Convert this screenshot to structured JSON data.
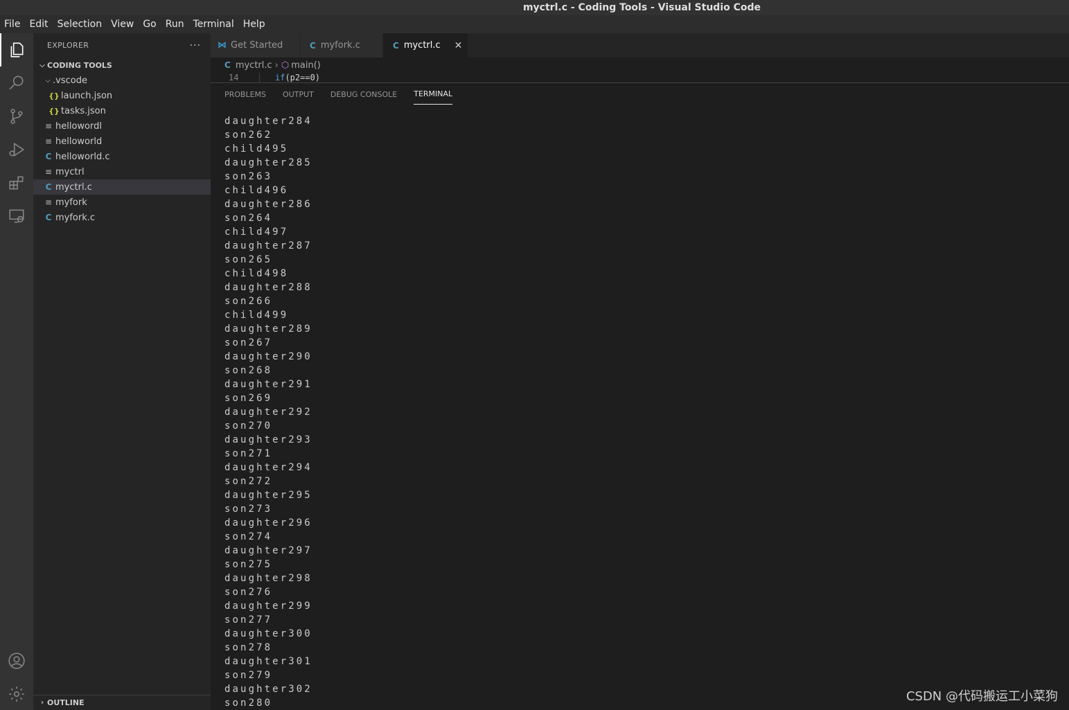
{
  "window": {
    "title": "myctrl.c - Coding Tools - Visual Studio Code"
  },
  "menu": [
    "File",
    "Edit",
    "Selection",
    "View",
    "Go",
    "Run",
    "Terminal",
    "Help"
  ],
  "activity_icons": [
    "files-icon",
    "search-icon",
    "source-control-icon",
    "run-debug-icon",
    "extensions-icon",
    "remote-explorer-icon",
    "account-icon",
    "settings-gear-icon"
  ],
  "sidebar": {
    "title": "EXPLORER",
    "more": "···",
    "section": "CODING TOOLS",
    "folder": ".vscode",
    "files": {
      "launch": "launch.json",
      "tasks": "tasks.json",
      "f1": "hellowordl",
      "f2": "helloworld",
      "f3": "helloworld.c",
      "f4": "myctrl",
      "f5": "myctrl.c",
      "f6": "myfork",
      "f7": "myfork.c"
    },
    "outline": "OUTLINE"
  },
  "tabs": {
    "t1": "Get Started",
    "t2": "myfork.c",
    "t3": "myctrl.c",
    "c_glyph": "C"
  },
  "breadcrumb": {
    "file": "myctrl.c",
    "symbol": "main()"
  },
  "code": {
    "line_number": "14",
    "keyword": "if",
    "rest": "(p2==0)"
  },
  "panel": {
    "tabs": [
      "PROBLEMS",
      "OUTPUT",
      "DEBUG CONSOLE",
      "TERMINAL"
    ],
    "terminal_lines": [
      "daughter284",
      "son262",
      "child495",
      "daughter285",
      "son263",
      "child496",
      "daughter286",
      "son264",
      "child497",
      "daughter287",
      "son265",
      "child498",
      "daughter288",
      "son266",
      "child499",
      "daughter289",
      "son267",
      "daughter290",
      "son268",
      "daughter291",
      "son269",
      "daughter292",
      "son270",
      "daughter293",
      "son271",
      "daughter294",
      "son272",
      "daughter295",
      "son273",
      "daughter296",
      "son274",
      "daughter297",
      "son275",
      "daughter298",
      "son276",
      "daughter299",
      "son277",
      "daughter300",
      "son278",
      "daughter301",
      "son279",
      "daughter302",
      "son280"
    ]
  },
  "watermark": "CSDN @代码搬运工小菜狗"
}
